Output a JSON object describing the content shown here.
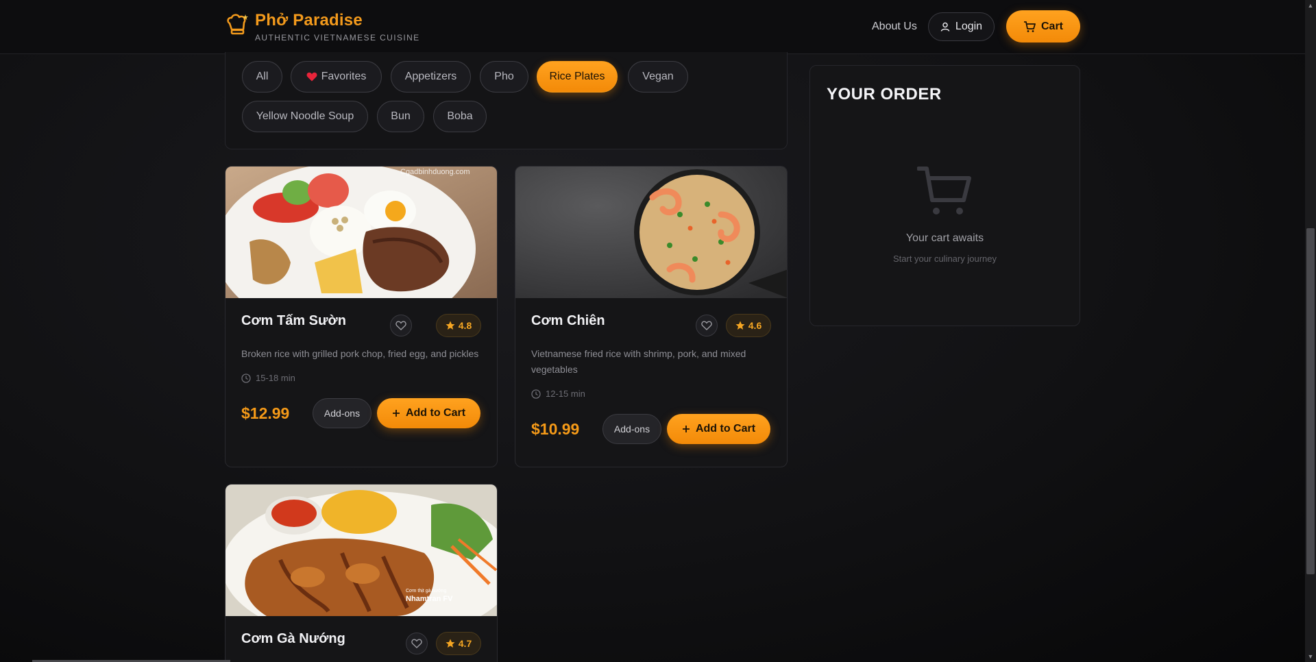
{
  "header": {
    "brand_title": "Phở Paradise",
    "brand_subtitle": "AUTHENTIC VIETNAMESE CUISINE",
    "brand_icon": "chef-hat-icon",
    "nav_about": "About Us",
    "nav_login": "Login",
    "nav_cart": "Cart"
  },
  "filters": [
    {
      "label": "All",
      "active": false
    },
    {
      "label": "Favorites",
      "active": false,
      "icon": "heart-icon"
    },
    {
      "label": "Appetizers",
      "active": false
    },
    {
      "label": "Pho",
      "active": false
    },
    {
      "label": "Rice Plates",
      "active": true
    },
    {
      "label": "Vegan",
      "active": false
    },
    {
      "label": "Yellow Noodle Soup",
      "active": false
    },
    {
      "label": "Bun",
      "active": false
    },
    {
      "label": "Boba",
      "active": false
    }
  ],
  "menu_items": [
    {
      "name": "Cơm Tấm Sườn",
      "rating": "4.8",
      "description": "Broken rice with grilled pork chop, fried egg, and pickles",
      "time": "15-18 min",
      "price": "$12.99",
      "addons_label": "Add-ons",
      "add_label": "Add to Cart",
      "image_watermark": "Cgadbinhduong.com"
    },
    {
      "name": "Cơm Chiên",
      "rating": "4.6",
      "description": "Vietnamese fried rice with shrimp, pork, and mixed vegetables",
      "time": "12-15 min",
      "price": "$10.99",
      "addons_label": "Add-ons",
      "add_label": "Add to Cart"
    },
    {
      "name": "Cơm Gà Nướng",
      "rating": "4.7",
      "image_caption_small": "Cơm thịt gà nướng",
      "image_caption": "Nhamtran FV"
    }
  ],
  "order": {
    "title": "YOUR ORDER",
    "empty_title": "Your cart awaits",
    "empty_subtitle": "Start your culinary journey"
  },
  "colors": {
    "accent": "#f59a18",
    "background": "#111113",
    "card": "#151517"
  }
}
